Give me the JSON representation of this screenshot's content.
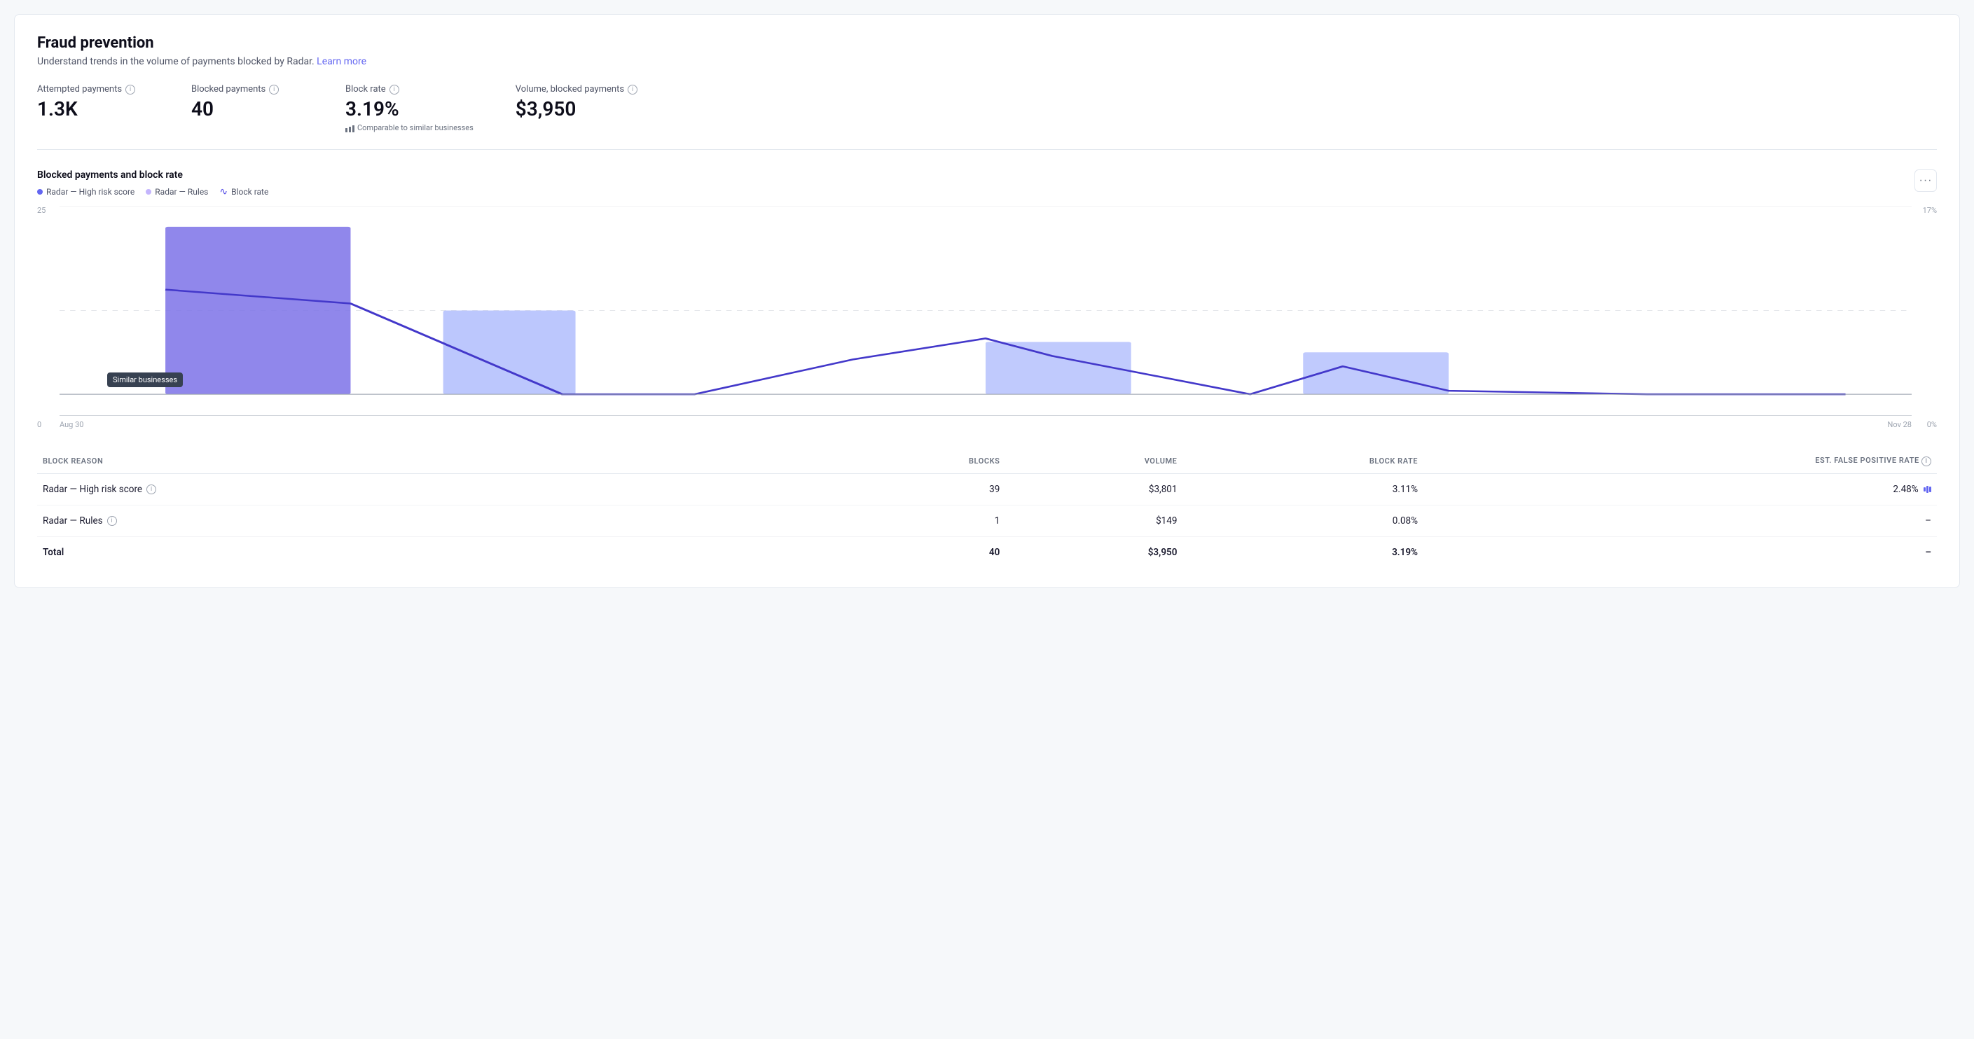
{
  "page": {
    "title": "Fraud prevention",
    "subtitle": "Understand trends in the volume of payments blocked by Radar.",
    "learn_more": "Learn more"
  },
  "metrics": [
    {
      "id": "attempted_payments",
      "label": "Attempted payments",
      "value": "1.3K",
      "note": null
    },
    {
      "id": "blocked_payments",
      "label": "Blocked payments",
      "value": "40",
      "note": null
    },
    {
      "id": "block_rate",
      "label": "Block rate",
      "value": "3.19%",
      "note": "Comparable to similar businesses"
    },
    {
      "id": "volume_blocked",
      "label": "Volume, blocked payments",
      "value": "$3,950",
      "note": null
    }
  ],
  "chart": {
    "title": "Blocked payments and block rate",
    "legend": [
      {
        "id": "radar_high",
        "label": "Radar — High risk score",
        "type": "dot-dark"
      },
      {
        "id": "radar_rules",
        "label": "Radar — Rules",
        "type": "dot-light"
      },
      {
        "id": "block_rate",
        "label": "Block rate",
        "type": "wave"
      }
    ],
    "x_labels": [
      "Aug 30",
      "Nov 28"
    ],
    "y_left": [
      "25",
      "0"
    ],
    "y_right": [
      "17%",
      "0%"
    ],
    "tooltip": "Similar businesses",
    "more_button": "···"
  },
  "table": {
    "columns": [
      {
        "id": "reason",
        "label": "Block reason",
        "align": "left"
      },
      {
        "id": "blocks",
        "label": "Blocks",
        "align": "right"
      },
      {
        "id": "volume",
        "label": "Volume",
        "align": "right"
      },
      {
        "id": "block_rate",
        "label": "Block rate",
        "align": "right"
      },
      {
        "id": "est_fpr",
        "label": "Est. false positive rate",
        "align": "right"
      }
    ],
    "rows": [
      {
        "reason": "Radar — High risk score",
        "has_info": true,
        "blocks": "39",
        "volume": "$3,801",
        "block_rate": "3.11%",
        "est_fpr": "2.48%",
        "has_chart_icon": true
      },
      {
        "reason": "Radar — Rules",
        "has_info": true,
        "blocks": "1",
        "volume": "$149",
        "block_rate": "0.08%",
        "est_fpr": "–",
        "has_chart_icon": false
      },
      {
        "reason": "Total",
        "has_info": false,
        "blocks": "40",
        "volume": "$3,950",
        "block_rate": "3.19%",
        "est_fpr": "–",
        "has_chart_icon": false
      }
    ]
  }
}
